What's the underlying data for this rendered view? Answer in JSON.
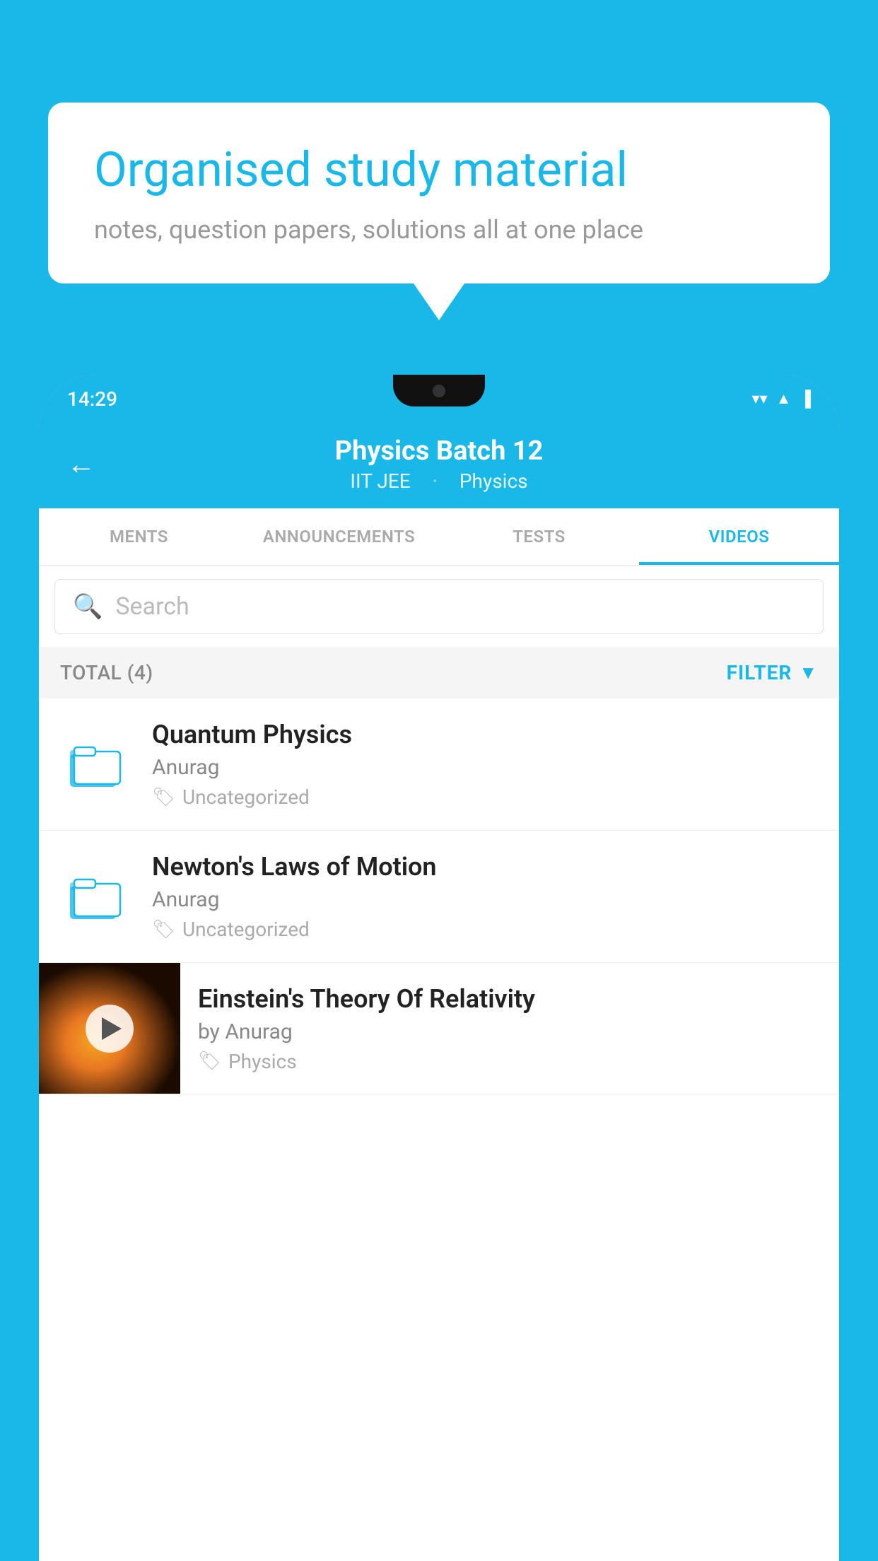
{
  "background_color": "#1AB8E8",
  "bubble": {
    "title": "Organised study material",
    "subtitle": "notes, question papers, solutions all at one place"
  },
  "phone": {
    "status_bar": {
      "time": "14:29"
    },
    "app_bar": {
      "title": "Physics Batch 12",
      "subtitle_parts": [
        "IIT JEE",
        "Physics"
      ],
      "back_label": "←"
    },
    "tabs": [
      {
        "label": "MENTS",
        "active": false
      },
      {
        "label": "ANNOUNCEMENTS",
        "active": false
      },
      {
        "label": "TESTS",
        "active": false
      },
      {
        "label": "VIDEOS",
        "active": true
      }
    ],
    "search": {
      "placeholder": "Search"
    },
    "filter_bar": {
      "total": "TOTAL (4)",
      "filter_label": "FILTER"
    },
    "videos": [
      {
        "id": 1,
        "title": "Quantum Physics",
        "author": "Anurag",
        "tag": "Uncategorized",
        "has_thumbnail": false
      },
      {
        "id": 2,
        "title": "Newton's Laws of Motion",
        "author": "Anurag",
        "tag": "Uncategorized",
        "has_thumbnail": false
      },
      {
        "id": 3,
        "title": "Einstein's Theory Of Relativity",
        "author": "by Anurag",
        "tag": "Physics",
        "has_thumbnail": true
      }
    ]
  }
}
